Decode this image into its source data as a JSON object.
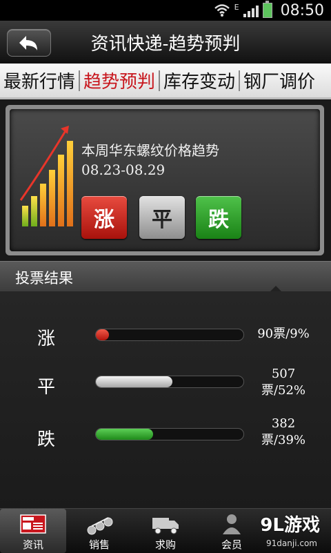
{
  "status_bar": {
    "time": "08:50",
    "network": "E"
  },
  "header": {
    "title": "资讯快递-趋势预判",
    "back_icon": "back-arrow-icon"
  },
  "tabs": [
    {
      "label": "最新行情",
      "active": false
    },
    {
      "label": "趋势预判",
      "active": true
    },
    {
      "label": "库存变动",
      "active": false
    },
    {
      "label": "钢厂调价",
      "active": false
    }
  ],
  "forecast": {
    "question": "本周华东螺纹价格趋势08.23-08.29",
    "buttons": {
      "up": "涨",
      "flat": "平",
      "down": "跌"
    }
  },
  "results": {
    "title": "投票结果",
    "rows": [
      {
        "label": "涨",
        "value": "90票/9%",
        "fraction": 0.09,
        "color": "#d0251c"
      },
      {
        "label": "平",
        "value": "507票/52%",
        "fraction": 0.52,
        "color": "#cfcfcf"
      },
      {
        "label": "跌",
        "value": "382票/39%",
        "fraction": 0.39,
        "color": "#2fa52a"
      }
    ]
  },
  "bottom_nav": [
    {
      "label": "资讯",
      "icon": "news-icon",
      "active": true
    },
    {
      "label": "销售",
      "icon": "steel-pipes-icon",
      "active": false
    },
    {
      "label": "求购",
      "icon": "truck-icon",
      "active": false
    },
    {
      "label": "会员",
      "icon": "member-icon",
      "active": false
    }
  ],
  "watermark": {
    "brand": "9L游戏",
    "url": "91danji.com"
  },
  "colors": {
    "accent_red": "#c8161d",
    "up_red": "#d0251c",
    "down_green": "#2fa52a"
  }
}
